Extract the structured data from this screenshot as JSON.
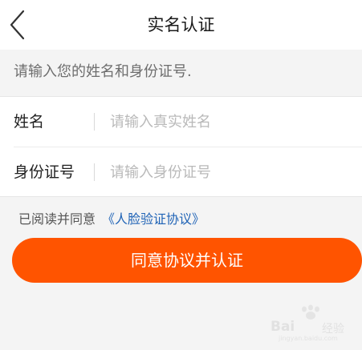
{
  "header": {
    "title": "实名认证",
    "back_icon": "chevron-left-icon"
  },
  "hint": {
    "text": "请输入您的姓名和身份证号."
  },
  "form": {
    "name": {
      "label": "姓名",
      "value": "",
      "placeholder": "请输入真实姓名"
    },
    "id_number": {
      "label": "身份证号",
      "value": "",
      "placeholder": "请输入身份证号"
    }
  },
  "agreement": {
    "prefix": "已阅读并同意",
    "link_text": "《人脸验证协议》"
  },
  "submit": {
    "label": "同意协议并认证"
  },
  "watermark": {
    "brand": "Bai",
    "suffix": "经验",
    "url": "jingyan.baidu.com"
  },
  "colors": {
    "accent": "#ff5400",
    "link": "#1f63b6",
    "background": "#f4f4f4"
  }
}
